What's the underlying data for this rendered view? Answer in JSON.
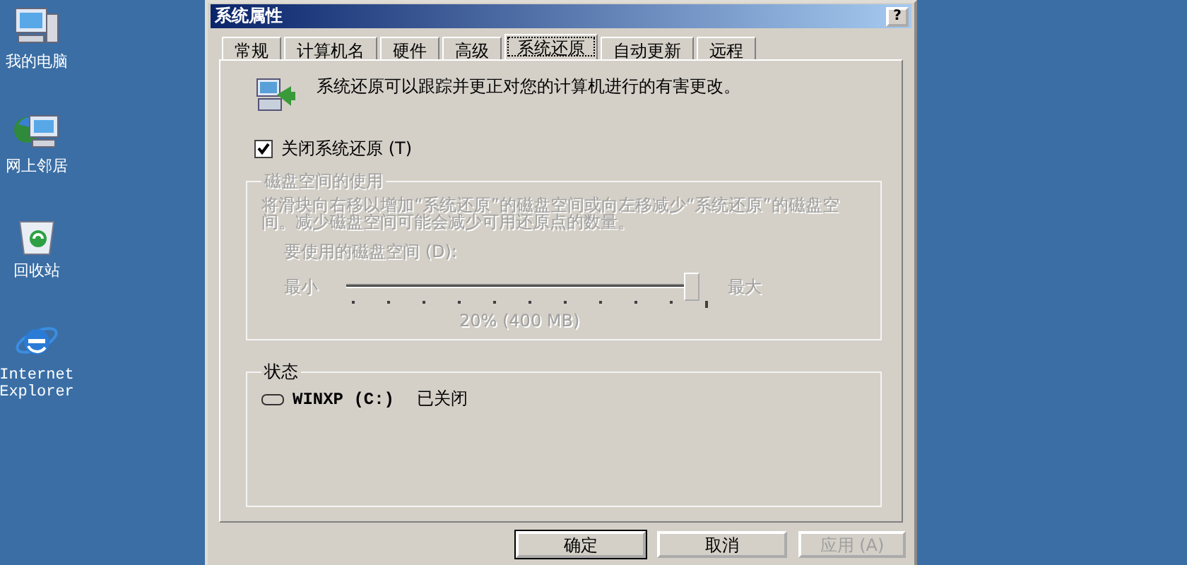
{
  "desktop_icons": [
    {
      "kind": "computer",
      "label": "我的电脑"
    },
    {
      "kind": "network",
      "label": "网上邻居"
    },
    {
      "kind": "recycle",
      "label": "回收站"
    },
    {
      "kind": "browser",
      "label": "Internet Explorer"
    }
  ],
  "dialog": {
    "title": "系统属性",
    "help_button": "?",
    "tabs": [
      {
        "label": "常规",
        "selected": false
      },
      {
        "label": "计算机名",
        "selected": false
      },
      {
        "label": "硬件",
        "selected": false
      },
      {
        "label": "高级",
        "selected": false
      },
      {
        "label": "系统还原",
        "selected": true
      },
      {
        "label": "自动更新",
        "selected": false
      },
      {
        "label": "远程",
        "selected": false
      }
    ],
    "description": "系统还原可以跟踪并更正对您的计算机进行的有害更改。",
    "disable_checkbox": {
      "label": "关闭系统还原 (T)",
      "checked": true
    },
    "disk_usage": {
      "title": "磁盘空间的使用",
      "disabled": true,
      "description": "将滑块向右移以增加“系统还原”的磁盘空间或向左移减少“系统还原”的磁盘空间。减少磁盘空间可能会减少可用还原点的数量。",
      "slider_label": "要使用的磁盘空间 (D):",
      "min_label": "最小",
      "max_label": "最大",
      "level": 1,
      "reading": "20% (400 MB)"
    },
    "status": {
      "title": "状态",
      "drives": [
        {
          "name": "WINXP (C:)",
          "state": "已关闭"
        }
      ]
    },
    "buttons": [
      {
        "label": "确定",
        "disabled": false,
        "default": true
      },
      {
        "label": "取消",
        "disabled": false,
        "default": false
      },
      {
        "label": "应用 (A)",
        "disabled": true,
        "default": false
      }
    ]
  }
}
